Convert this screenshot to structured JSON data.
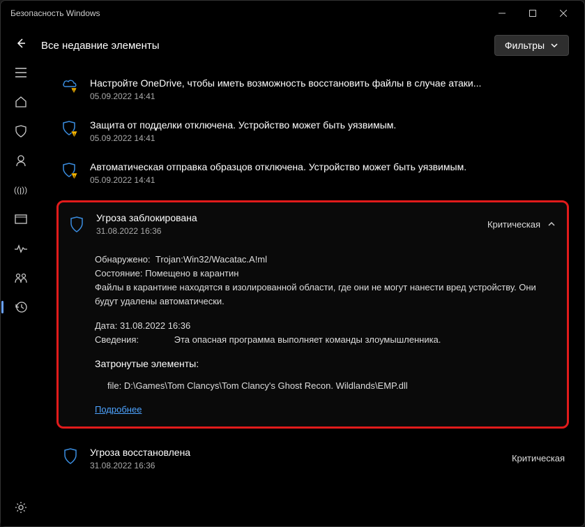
{
  "window": {
    "title": "Безопасность Windows"
  },
  "header": {
    "page_title": "Все недавние элементы",
    "filters_label": "Фильтры"
  },
  "sidebar": {
    "items": [
      {
        "name": "menu"
      },
      {
        "name": "home"
      },
      {
        "name": "shield"
      },
      {
        "name": "account"
      },
      {
        "name": "firewall"
      },
      {
        "name": "app-control"
      },
      {
        "name": "device-perf"
      },
      {
        "name": "family"
      },
      {
        "name": "history"
      }
    ],
    "bottom": {
      "name": "settings"
    }
  },
  "items": [
    {
      "icon": "onedrive-warn",
      "title": "Настройте OneDrive, чтобы иметь возможность восстановить файлы в случае атаки...",
      "date": "05.09.2022 14:41"
    },
    {
      "icon": "shield-warn",
      "title": "Защита от подделки отключена. Устройство может быть уязвимым.",
      "date": "05.09.2022 14:41"
    },
    {
      "icon": "shield-warn",
      "title": "Автоматическая отправка образцов отключена. Устройство может быть уязвимым.",
      "date": "05.09.2022 14:41"
    }
  ],
  "threat_card": {
    "icon": "shield",
    "title": "Угроза заблокирована",
    "date": "31.08.2022 16:36",
    "severity": "Критическая",
    "detected_label": "Обнаружено:",
    "detected_value": "Trojan:Win32/Wacatac.A!ml",
    "state_label": "Состояние:",
    "state_value": "Помещено в карантин",
    "state_desc": "Файлы в карантине находятся в изолированной области, где они не могут нанести вред устройству. Они будут удалены автоматически.",
    "date_label": "Дата:",
    "date_value": "31.08.2022 16:36",
    "info_label": "Сведения:",
    "info_value": "Эта опасная программа выполняет команды злоумышленника.",
    "affected_title": "Затронутые элементы:",
    "affected_file": "file: D:\\Games\\Tom Clancys\\Tom Clancy's Ghost Recon. Wildlands\\EMP.dll",
    "more_link": "Подробнее"
  },
  "item_restored": {
    "icon": "shield",
    "title": "Угроза восстановлена",
    "date": "31.08.2022 16:36",
    "severity": "Критическая"
  }
}
